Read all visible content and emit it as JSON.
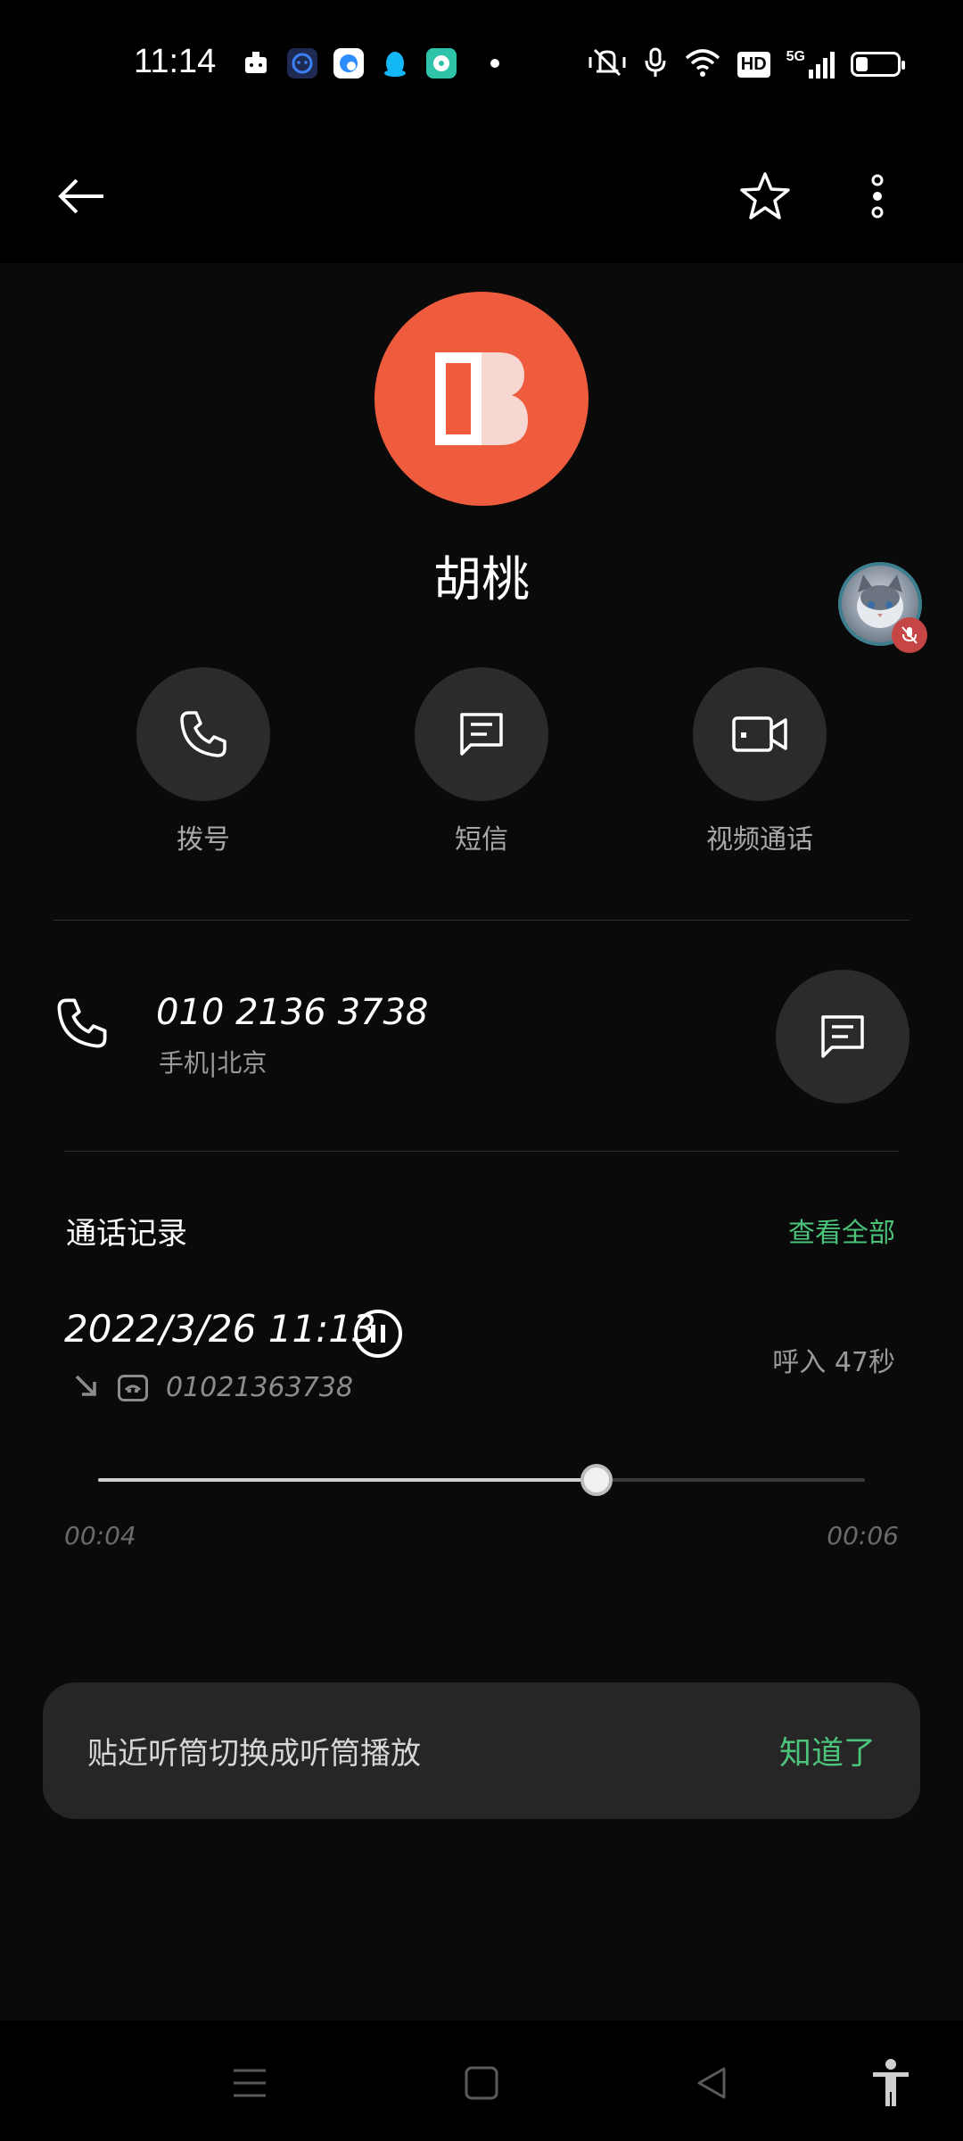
{
  "status_bar": {
    "time": "11:14",
    "network_label": "5G",
    "hd_label": "HD",
    "battery_level": 0.3
  },
  "contact": {
    "name": "胡桃"
  },
  "actions": {
    "call_label": "拨号",
    "sms_label": "短信",
    "video_label": "视频通话"
  },
  "phone": {
    "number": "010 2136 3738",
    "sub_label": "手机|北京"
  },
  "call_log": {
    "title": "通话记录",
    "view_all": "查看全部",
    "datetime": "2022/3/26 11:13",
    "type_duration": "呼入 47秒",
    "number": "01021363738",
    "playback": {
      "elapsed": "00:04",
      "remaining": "00:06",
      "progress": 0.65
    }
  },
  "snackbar": {
    "message": "贴近听筒切换成听筒播放",
    "action": "知道了"
  },
  "colors": {
    "accent_green": "#4cc37a",
    "avatar_orange": "#ee5b3d",
    "background": "#0a0a0a"
  }
}
